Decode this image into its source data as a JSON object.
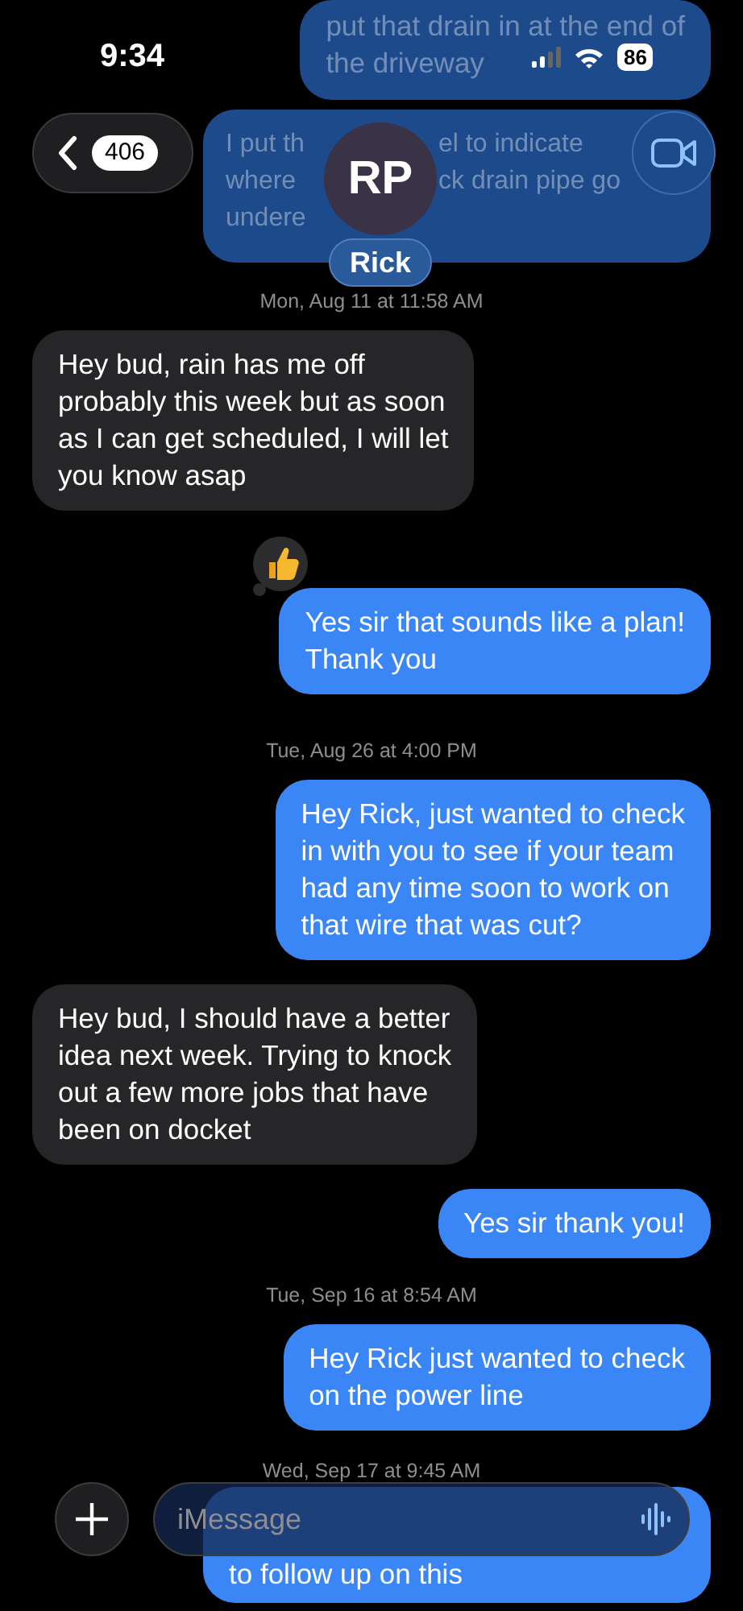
{
  "status_bar": {
    "time": "9:34",
    "battery": "86"
  },
  "header": {
    "back_count": "406",
    "avatar_initials": "RP",
    "contact_name": "Rick"
  },
  "messages": [
    {
      "kind": "bubble",
      "outgoing": true,
      "faded": true,
      "lines": [
        [
          "put that drain in at the end of"
        ],
        [
          "the driveway"
        ]
      ]
    },
    {
      "kind": "bubble",
      "outgoing": true,
      "faded": true,
      "lines": [
        [
          "I put th",
          "el to indicate"
        ],
        [
          "where",
          "ck drain pipe go"
        ],
        [
          "undere"
        ]
      ]
    },
    {
      "kind": "timestamp",
      "text": "Mon, Aug 11 at 11:58 AM"
    },
    {
      "kind": "bubble",
      "outgoing": false,
      "faded": false,
      "lines": [
        [
          "Hey bud, rain has me off"
        ],
        [
          "probably this week but as soon"
        ],
        [
          "as I can get scheduled, I will let"
        ],
        [
          "you know asap"
        ]
      ]
    },
    {
      "kind": "bubble",
      "outgoing": true,
      "faded": false,
      "tapback": true,
      "lines": [
        [
          "Yes sir that sounds like a plan!"
        ],
        [
          "Thank you"
        ]
      ]
    },
    {
      "kind": "timestamp",
      "text": "Tue, Aug 26 at 4:00 PM"
    },
    {
      "kind": "bubble",
      "outgoing": true,
      "faded": false,
      "lines": [
        [
          "Hey Rick, just wanted to check"
        ],
        [
          "in with you to see if your team"
        ],
        [
          "had any time soon to work on"
        ],
        [
          "that wire that was cut?"
        ]
      ]
    },
    {
      "kind": "bubble",
      "outgoing": false,
      "faded": false,
      "lines": [
        [
          "Hey bud, I should have a better"
        ],
        [
          "idea next week. Trying to knock"
        ],
        [
          "out a few more jobs that have"
        ],
        [
          "been on docket"
        ]
      ]
    },
    {
      "kind": "bubble",
      "outgoing": true,
      "faded": false,
      "lines": [
        [
          "Yes sir thank you!"
        ]
      ]
    },
    {
      "kind": "timestamp",
      "text": "Tue, Sep 16 at 8:54 AM"
    },
    {
      "kind": "bubble",
      "outgoing": true,
      "faded": false,
      "lines": [
        [
          "Hey Rick just wanted to check"
        ],
        [
          "on the power line"
        ]
      ]
    },
    {
      "kind": "timestamp",
      "text": "Wed, Sep 17 at 9:45 AM"
    },
    {
      "kind": "bubble",
      "outgoing": true,
      "faded": false,
      "under_composer": true,
      "lines": [
        [
          "to follow up on this"
        ]
      ]
    }
  ],
  "composer": {
    "placeholder": "iMessage"
  }
}
